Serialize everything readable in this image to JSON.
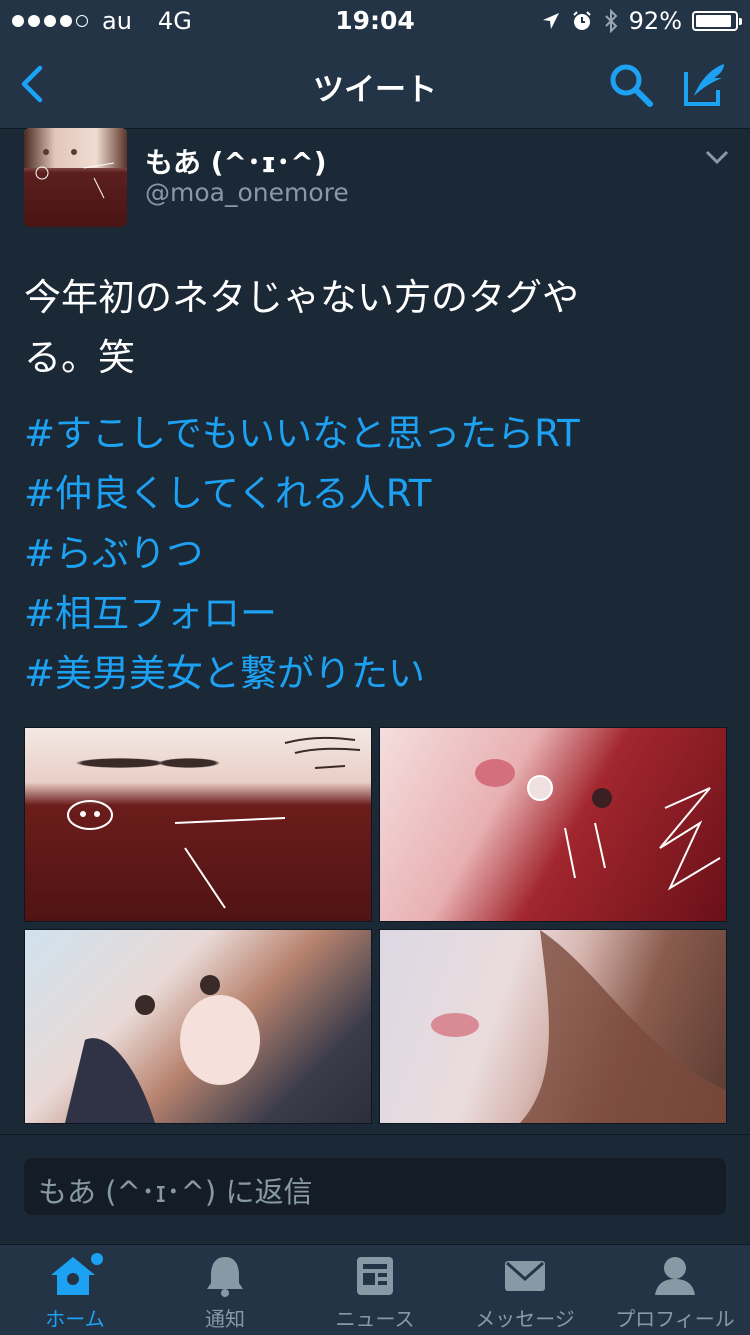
{
  "status_bar": {
    "carrier": "au",
    "network": "4G",
    "time": "19:04",
    "battery_percent": "92%",
    "battery_level": 0.92
  },
  "nav": {
    "title": "ツイート",
    "back_icon": "chevron-left-icon",
    "search_icon": "search-icon",
    "compose_icon": "compose-icon"
  },
  "tweet": {
    "display_name": "もあ (^･ɪ･^)",
    "handle": "@moa_onemore",
    "text_line1": "今年初のネタじゃない方のタグや",
    "text_line2": "る。笑",
    "hashtags": [
      "#すこしでもいいなと思ったらRT",
      "#仲良くしてくれる人RT",
      "#らぶりつ",
      "#相互フォロー",
      "#美男美女と繋がりたい"
    ]
  },
  "reply": {
    "placeholder": "もあ (^･ɪ･^) に返信"
  },
  "tabs": [
    {
      "label": "ホーム",
      "icon": "home-icon",
      "active": true
    },
    {
      "label": "通知",
      "icon": "bell-icon",
      "active": false
    },
    {
      "label": "ニュース",
      "icon": "news-icon",
      "active": false
    },
    {
      "label": "メッセージ",
      "icon": "envelope-icon",
      "active": false
    },
    {
      "label": "プロフィール",
      "icon": "profile-icon",
      "active": false
    }
  ],
  "colors": {
    "background": "#1b2836",
    "bar": "#243447",
    "accent": "#1da1f2",
    "secondary_text": "#8899a6"
  }
}
